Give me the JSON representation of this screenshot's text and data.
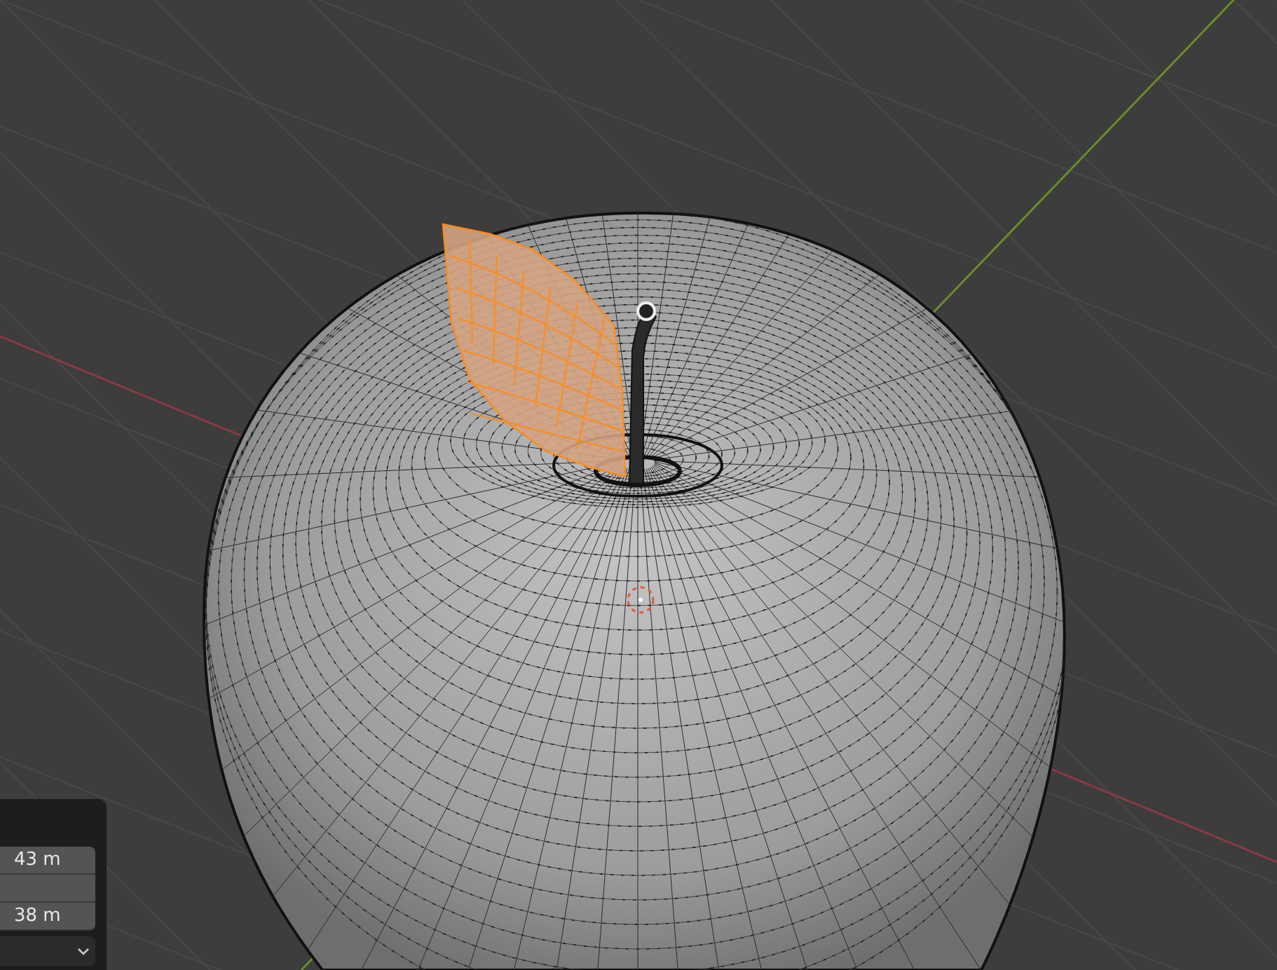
{
  "operator_panel": {
    "fields": [
      {
        "kind": "number",
        "value": "43 m"
      },
      {
        "kind": "blank"
      },
      {
        "kind": "number",
        "value": "38 m"
      },
      {
        "kind": "dropdown"
      }
    ]
  }
}
